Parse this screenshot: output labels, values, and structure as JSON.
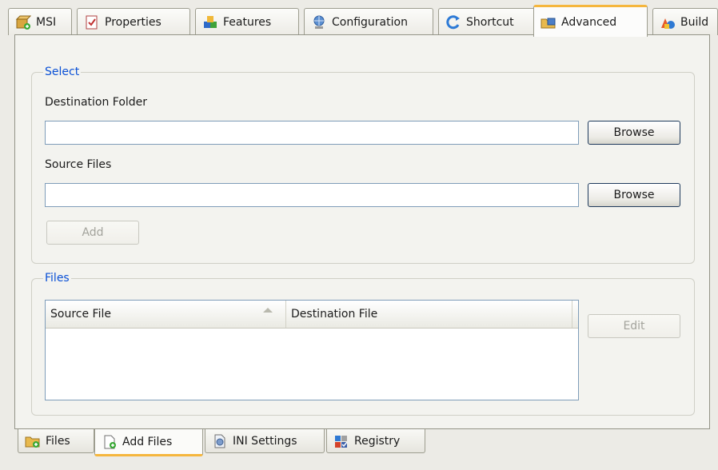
{
  "top_tabs": [
    {
      "label": "MSI",
      "icon": "msi-package-icon"
    },
    {
      "label": "Properties",
      "icon": "properties-checklist-icon"
    },
    {
      "label": "Features",
      "icon": "features-blocks-icon"
    },
    {
      "label": "Configuration",
      "icon": "configuration-globe-icon"
    },
    {
      "label": "Shortcut",
      "icon": "shortcut-arrow-icon"
    },
    {
      "label": "Advanced",
      "icon": "advanced-folder-icon",
      "active": true
    },
    {
      "label": "Build",
      "icon": "build-shapes-icon"
    }
  ],
  "select_group": {
    "legend": "Select",
    "destination_label": "Destination Folder",
    "destination_value": "",
    "destination_browse": "Browse",
    "source_label": "Source Files",
    "source_value": "",
    "source_browse": "Browse",
    "add_button": "Add"
  },
  "files_group": {
    "legend": "Files",
    "columns": [
      "Source File",
      "Destination File"
    ],
    "rows": [],
    "edit_button": "Edit"
  },
  "bottom_tabs": [
    {
      "label": "Files",
      "icon": "files-folder-icon"
    },
    {
      "label": "Add Files",
      "icon": "add-files-document-icon",
      "active": true
    },
    {
      "label": "INI Settings",
      "icon": "ini-settings-icon"
    },
    {
      "label": "Registry",
      "icon": "registry-icon"
    }
  ],
  "colors": {
    "accent_tab": "#f5b63d",
    "legend_text": "#0a50d6",
    "panel_bg": "#f3f3ef"
  }
}
